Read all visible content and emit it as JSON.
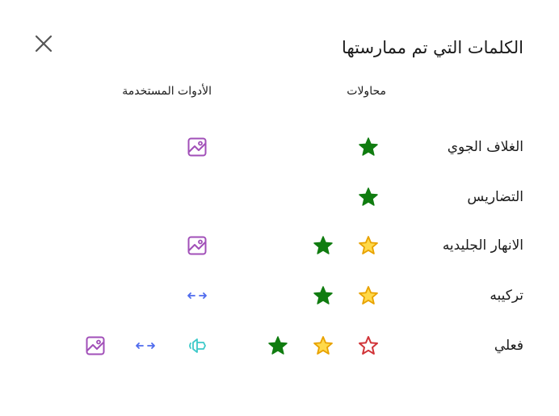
{
  "dialog": {
    "title": "الكلمات التي تم ممارستها",
    "close_icon": "close-icon"
  },
  "columns": {
    "attempts": "محاولات",
    "tools_used": "الأدوات المستخدمة"
  },
  "colors": {
    "star_green": "#107c10",
    "star_yellow_fill": "#ffd94a",
    "star_yellow_stroke": "#e8a200",
    "star_red_stroke": "#d13438",
    "tool_purple": "#a14fb8",
    "tool_blue": "#4f6bed",
    "tool_teal": "#3cc9c9"
  },
  "rows": [
    {
      "word": "الغلاف الجوي",
      "attempts": [
        "star-green-icon"
      ],
      "tools": [
        "image-icon"
      ]
    },
    {
      "word": "التضاريس",
      "attempts": [
        "star-green-icon"
      ],
      "tools": []
    },
    {
      "word": "الانهار الجليديه",
      "attempts": [
        "star-yellow-icon",
        "star-green-icon"
      ],
      "tools": [
        "image-icon"
      ]
    },
    {
      "word": "تركيبه",
      "attempts": [
        "star-yellow-icon",
        "star-green-icon"
      ],
      "tools": [
        "syllables-icon"
      ]
    },
    {
      "word": "فعلي",
      "attempts": [
        "star-red-icon",
        "star-yellow-icon",
        "star-green-icon"
      ],
      "tools": [
        "speaker-icon",
        "syllables-icon",
        "image-icon"
      ]
    }
  ]
}
